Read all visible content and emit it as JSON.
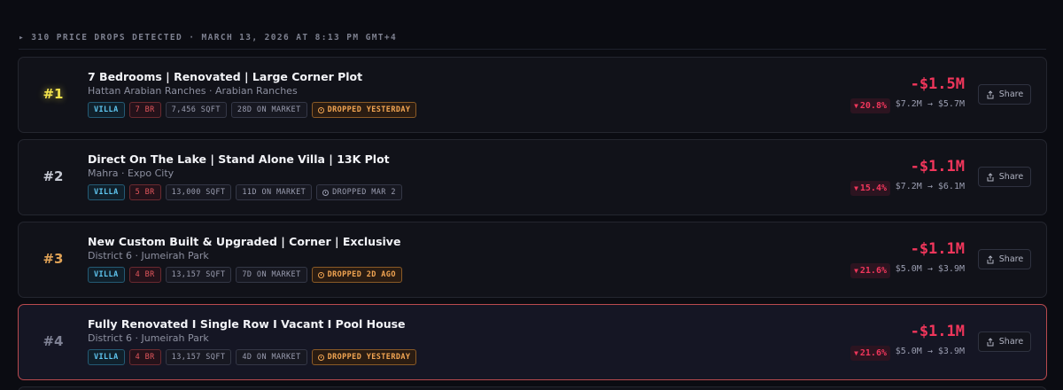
{
  "header": {
    "summary": "▸ 310 PRICE DROPS DETECTED · MARCH 13, 2026 AT 8:13 PM GMT+4"
  },
  "colors": {
    "background": "#0b0c12",
    "card": "#111219",
    "accent_drop": "#f0365b",
    "villa_tag": "#5fc6f0",
    "beds_tag": "#e2565c",
    "recent_drop_tag": "#f2a552",
    "highlight_border": "#b94a4e"
  },
  "share_label": "Share",
  "listings": [
    {
      "rank": "#1",
      "title": "7 Bedrooms | Renovated | Large Corner Plot",
      "location": "Hattan Arabian Ranches · Arabian Ranches",
      "type": "VILLA",
      "beds": "7 BR",
      "sqft": "7,456 SQFT",
      "days": "28D ON MARKET",
      "dropped": "DROPPED YESTERDAY",
      "drop": "-$1.5M",
      "pct": "20.8%",
      "from_to": "$7.2M → $5.7M"
    },
    {
      "rank": "#2",
      "title": "Direct On The Lake | Stand Alone Villa | 13K Plot",
      "location": "Mahra · Expo City",
      "type": "VILLA",
      "beds": "5 BR",
      "sqft": "13,000 SQFT",
      "days": "11D ON MARKET",
      "dropped": "DROPPED MAR 2",
      "drop": "-$1.1M",
      "pct": "15.4%",
      "from_to": "$7.2M → $6.1M"
    },
    {
      "rank": "#3",
      "title": "New Custom Built & Upgraded | Corner | Exclusive",
      "location": "District 6 · Jumeirah Park",
      "type": "VILLA",
      "beds": "4 BR",
      "sqft": "13,157 SQFT",
      "days": "7D ON MARKET",
      "dropped": "DROPPED 2D AGO",
      "drop": "-$1.1M",
      "pct": "21.6%",
      "from_to": "$5.0M → $3.9M"
    },
    {
      "rank": "#4",
      "title": "Fully Renovated I Single Row I Vacant I Pool House",
      "location": "District 6 · Jumeirah Park",
      "type": "VILLA",
      "beds": "4 BR",
      "sqft": "13,157 SQFT",
      "days": "4D ON MARKET",
      "dropped": "DROPPED YESTERDAY",
      "drop": "-$1.1M",
      "pct": "21.6%",
      "from_to": "$5.0M → $3.9M"
    }
  ]
}
